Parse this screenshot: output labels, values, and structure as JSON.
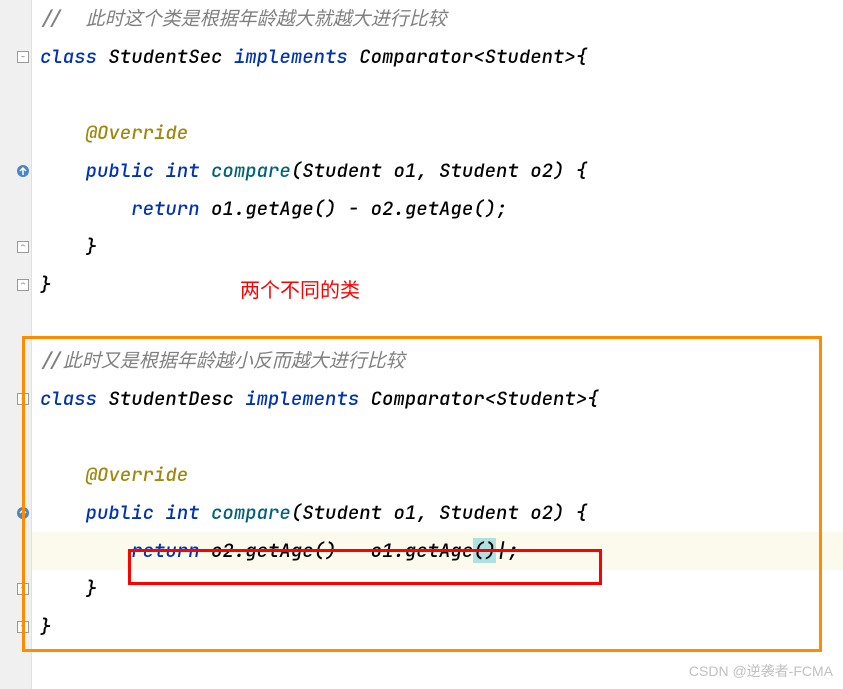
{
  "line1": {
    "comment": "//  此时这个类是根据年龄越大就越大进行比较"
  },
  "line2": {
    "kw1": "class ",
    "cls": "StudentSec ",
    "kw2": "implements ",
    "type": "Comparator<Student>{"
  },
  "line4": {
    "anno": "@Override"
  },
  "line5": {
    "kw1": "public ",
    "kw2": "int ",
    "method": "compare",
    "params": "(Student o1, Student o2) {"
  },
  "line6": {
    "kw": "return ",
    "expr": "o1.getAge() - o2.getAge();"
  },
  "line7": {
    "brace": "}"
  },
  "line8": {
    "brace": "}"
  },
  "redLabel": "两个不同的类",
  "line9": {
    "comment": "//此时又是根据年龄越小反而越大进行比较"
  },
  "line10": {
    "kw1": "class ",
    "cls": "StudentDesc ",
    "kw2": "implements ",
    "type": "Comparator<Student>{"
  },
  "line12": {
    "anno": "@Override"
  },
  "line13": {
    "kw1": "public ",
    "kw2": "int ",
    "method": "compare",
    "params": "(Student o1, Student o2) {"
  },
  "line14": {
    "kw": "return ",
    "expr1": "o2.getAge() - o1.getAge",
    "hl": "()",
    "expr2": ";"
  },
  "line15": {
    "brace": "}"
  },
  "line16": {
    "brace": "}"
  },
  "watermark": "CSDN @逆袭者-FCMA"
}
